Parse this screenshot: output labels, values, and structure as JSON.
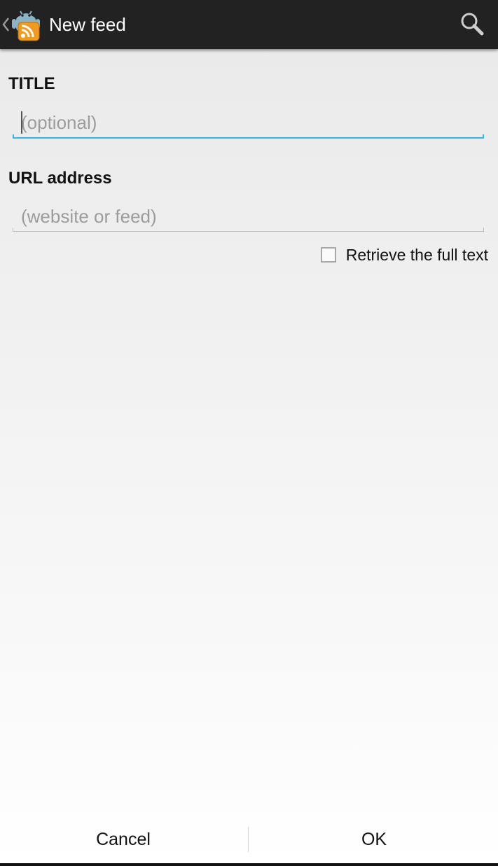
{
  "action_bar": {
    "title": "New feed",
    "up_icon": "chevron-left-icon",
    "app_icon": "android-rss-feed-icon",
    "search_icon": "search-icon",
    "background": "#222222"
  },
  "form": {
    "title_label": "TITLE",
    "title_placeholder": "(optional)",
    "title_value": "",
    "url_label": "URL address",
    "url_placeholder": "(website or feed)",
    "url_value": "",
    "full_text_label": "Retrieve the full text",
    "full_text_checked": false,
    "focus_color": "#33b5e5"
  },
  "buttons": {
    "cancel_label": "Cancel",
    "ok_label": "OK"
  }
}
